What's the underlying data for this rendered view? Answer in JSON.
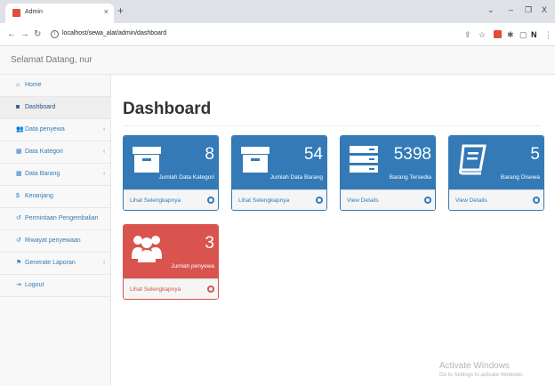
{
  "browser": {
    "tab_title": "Admin",
    "tab_close": "×",
    "new_tab": "+",
    "url": "localhost/sewa_alat/admin/dashboard",
    "win_min": "–",
    "win_max": "❐",
    "win_close": "X"
  },
  "header": {
    "brand": "Selamat Datang, nur"
  },
  "sidebar": {
    "items": [
      {
        "label": "Home",
        "icon": "home-icon"
      },
      {
        "label": "Dashboard",
        "icon": "dashboard-icon"
      },
      {
        "label": "Data penyewa",
        "icon": "users-icon"
      },
      {
        "label": "Data Kategori",
        "icon": "table-icon"
      },
      {
        "label": "Data Barang",
        "icon": "table-icon"
      },
      {
        "label": "Keranjang",
        "icon": "dollar-icon"
      },
      {
        "label": "Permintaan Pengembalian",
        "icon": "history-icon"
      },
      {
        "label": "Riwayat penyewaan",
        "icon": "history-icon"
      },
      {
        "label": "Generate Laporan",
        "icon": "flag-icon"
      },
      {
        "label": "Logout",
        "icon": "logout-icon"
      }
    ]
  },
  "main": {
    "title": "Dashboard",
    "cards": [
      {
        "value": "8",
        "caption": "Jumlah Data Kategori",
        "link": "Lihat Selengkapnya",
        "icon": "archive-icon",
        "color": "#337ab7"
      },
      {
        "value": "54",
        "caption": "Jumlah Data Barang",
        "link": "Lihat Selengkapnya",
        "icon": "archive-icon",
        "color": "#337ab7"
      },
      {
        "value": "5398",
        "caption": "Barang Tersedia",
        "link": "View Details",
        "icon": "server-icon",
        "color": "#337ab7"
      },
      {
        "value": "5",
        "caption": "Barang Disewa",
        "link": "View Details",
        "icon": "book-icon",
        "color": "#337ab7"
      },
      {
        "value": "3",
        "caption": "Jumlah penyewa",
        "link": "Lihat Selengkapnya",
        "icon": "users-icon",
        "color": "#d9534f"
      }
    ]
  },
  "watermark": {
    "line1": "Activate Windows",
    "line2": "Go to Settings to activate Windows."
  }
}
